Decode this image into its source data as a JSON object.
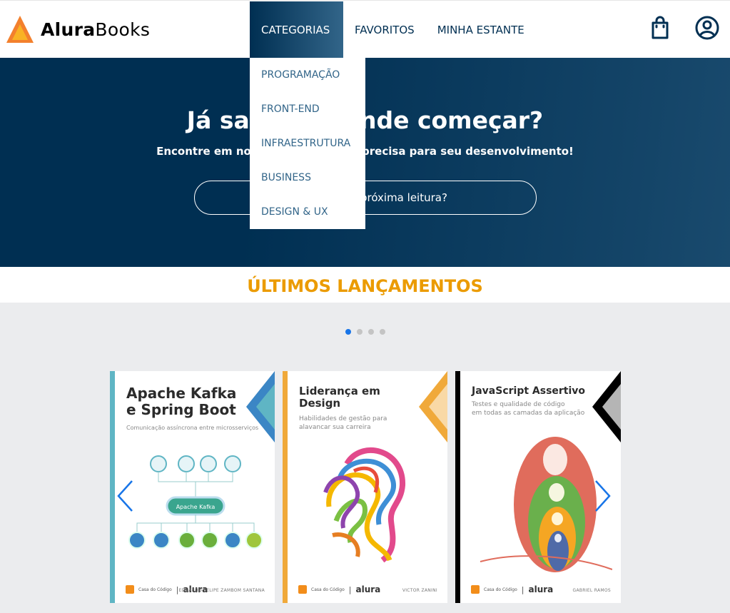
{
  "brand": {
    "name_bold": "Alura",
    "name_regular": "Books"
  },
  "nav": {
    "items": [
      "CATEGORIAS",
      "FAVORITOS",
      "MINHA ESTANTE"
    ],
    "active": "CATEGORIAS"
  },
  "dropdown": {
    "items": [
      "PROGRAMAÇÃO",
      "FRONT-END",
      "INFRAESTRUTURA",
      "BUSINESS",
      "DESIGN & UX"
    ]
  },
  "hero": {
    "title": "Já sabe por onde começar?",
    "subtitle": "Encontre em nossa estante o que precisa para seu desenvolvimento!",
    "search_placeholder": "Qual será sua próxima leitura?"
  },
  "releases": {
    "title": "ÚLTIMOS LANÇAMENTOS",
    "active_dot": 0,
    "dot_count": 4,
    "books": [
      {
        "title_line1": "Apache Kafka",
        "title_line2": "e Spring Boot",
        "subtitle": "Comunicação assíncrona entre microsserviços",
        "author": "EDUARDO FELIPE ZAMBOM SANTANA",
        "center_label": "Apache Kafka",
        "accent": "#5fb5c4"
      },
      {
        "title_line1": "Liderança em",
        "title_line2": "Design",
        "subtitle_line1": "Habilidades de gestão para",
        "subtitle_line2": "alavancar sua carreira",
        "author": "VICTOR ZANINI",
        "accent": "#f0a93a"
      },
      {
        "title_line1": "JavaScript Assertivo",
        "subtitle_line1": "Testes e qualidade de código",
        "subtitle_line2": "em todas as camadas da aplicação",
        "author": "GABRIEL RAMOS",
        "accent": "#000000"
      }
    ],
    "publisher_left": "Casa do Código",
    "publisher_right": "alura"
  },
  "colors": {
    "primary": "#002f52",
    "accent": "#eb9b00",
    "dot_active": "#1875e8"
  }
}
